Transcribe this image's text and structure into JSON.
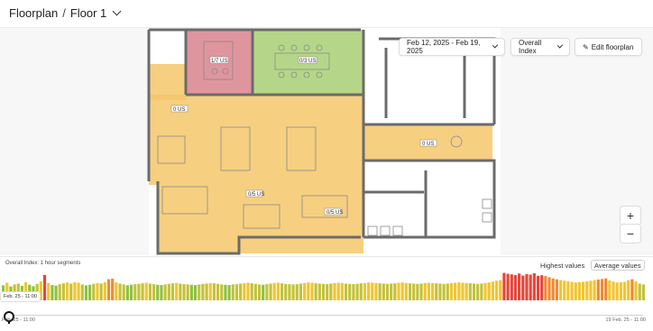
{
  "breadcrumb": {
    "root": "Floorplan",
    "separator": "/",
    "current": "Floor 1"
  },
  "controls": {
    "date_range": "Feb 12, 2025 - Feb 19, 2025",
    "index_select": "Overall Index",
    "edit_button": "Edit floorplan",
    "zoom_in": "+",
    "zoom_out": "−"
  },
  "zones": [
    {
      "id": "red-room",
      "label": "1/7 US",
      "color": "#d9828d"
    },
    {
      "id": "green-room",
      "label": "0/3 US",
      "color": "#a8cf73"
    },
    {
      "id": "yellow-small",
      "label": "0 US",
      "color": "#f5c76a"
    },
    {
      "id": "yellow-main",
      "label": "0/5 US",
      "color": "#f5c76a"
    },
    {
      "id": "yellow-corridor",
      "label": "0 US",
      "color": "#f5c76a"
    },
    {
      "id": "yellow-bottom",
      "label": "0/5 US",
      "color": "#f5c76a"
    }
  ],
  "chart": {
    "caption": "Overall Index: 1 hour segments",
    "highest_button": "Highest values",
    "average_button": "Average values",
    "hover_label": "Feb. 25 - 11:00",
    "start_label": "Feb. 25 - 11:00",
    "end_label": "19 Feb. 25 - 11:00"
  },
  "colors": {
    "red": "#e5463a",
    "orange": "#f08a34",
    "yellow": "#f1c52f",
    "olive": "#c3c23a",
    "green": "#8fc23c"
  },
  "chart_data": {
    "type": "bar",
    "title": "",
    "series": [
      {
        "values": [
          52,
          61,
          48,
          55,
          58,
          50,
          63,
          54,
          49,
          57,
          66,
          88,
          60,
          53,
          51,
          56,
          59,
          62,
          58,
          63,
          61,
          55,
          52,
          54,
          57,
          60,
          58,
          63,
          73,
          75,
          62,
          58,
          55,
          52,
          54,
          56,
          57,
          59,
          61,
          58,
          56,
          54,
          53,
          55,
          57,
          59,
          60,
          58,
          56,
          55,
          54,
          53,
          55,
          57,
          58,
          60,
          59,
          57,
          55,
          54,
          53,
          55,
          56,
          58,
          60,
          61,
          59,
          57,
          55,
          54,
          56,
          58,
          60,
          61,
          59,
          57,
          56,
          55,
          56,
          58,
          60,
          62,
          61,
          59,
          58,
          57,
          56,
          58,
          60,
          61,
          60,
          58,
          57,
          56,
          57,
          59,
          60,
          62,
          61,
          60,
          59,
          58,
          57,
          58,
          59,
          61,
          62,
          60,
          59,
          58,
          57,
          58,
          60,
          61,
          60,
          59,
          58,
          57,
          58,
          60,
          61,
          62,
          61,
          60,
          59,
          58,
          57,
          58,
          60,
          62,
          65,
          68,
          70,
          95,
          92,
          90,
          88,
          93,
          86,
          91,
          89,
          94,
          85,
          87,
          84,
          80,
          76,
          73,
          70,
          68,
          66,
          64,
          62,
          63,
          64,
          66,
          68,
          70,
          72,
          74,
          76,
          69,
          65,
          62,
          63,
          64,
          70,
          73,
          66,
          58,
          55
        ]
      }
    ]
  }
}
